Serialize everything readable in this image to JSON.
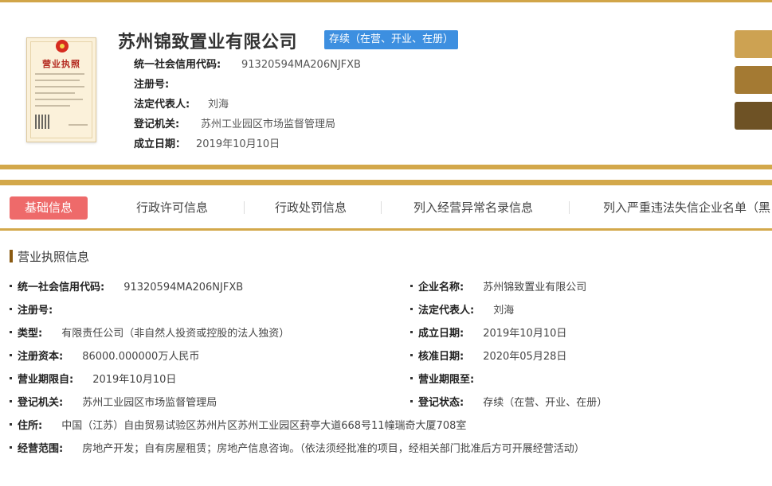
{
  "header": {
    "company_name": "苏州锦致置业有限公司",
    "status": "存续（在营、开业、在册）",
    "credit_code_label": "统一社会信用代码:",
    "credit_code": "91320594MA206NJFXB",
    "reg_no_label": "注册号:",
    "reg_no": "",
    "legal_rep_label": "法定代表人:",
    "legal_rep": "刘海",
    "authority_label": "登记机关:",
    "authority": "苏州工业园区市场监督管理局",
    "est_date_label": "成立日期：",
    "est_date": "2019年10月10日"
  },
  "license": {
    "title": "营业执照"
  },
  "tabs": [
    {
      "label": "基础信息",
      "active": true
    },
    {
      "label": "行政许可信息"
    },
    {
      "label": "行政处罚信息"
    },
    {
      "label": "列入经营异常名录信息"
    },
    {
      "label": "列入严重违法失信企业名单（黑"
    }
  ],
  "section": {
    "title": "营业执照信息",
    "fields": {
      "credit_code": {
        "label": "统一社会信用代码:",
        "value": "91320594MA206NJFXB"
      },
      "company_name": {
        "label": "企业名称:",
        "value": "苏州锦致置业有限公司"
      },
      "reg_no": {
        "label": "注册号:",
        "value": ""
      },
      "legal_rep": {
        "label": "法定代表人:",
        "value": "刘海"
      },
      "type": {
        "label": "类型:",
        "value": "有限责任公司（非自然人投资或控股的法人独资）"
      },
      "est_date": {
        "label": "成立日期:",
        "value": "2019年10月10日"
      },
      "capital": {
        "label": "注册资本:",
        "value": "86000.000000万人民币"
      },
      "approve_date": {
        "label": "核准日期:",
        "value": "2020年05月28日"
      },
      "term_from": {
        "label": "营业期限自:",
        "value": "2019年10月10日"
      },
      "term_to": {
        "label": "营业期限至:",
        "value": ""
      },
      "authority": {
        "label": "登记机关:",
        "value": "苏州工业园区市场监督管理局"
      },
      "reg_status": {
        "label": "登记状态:",
        "value": "存续（在营、开业、在册）"
      },
      "address": {
        "label": "住所:",
        "value": "中国（江苏）自由贸易试验区苏州片区苏州工业园区葑亭大道668号11幢瑞奇大厦708室"
      },
      "scope": {
        "label": "经营范围:",
        "value": "房地产开发；自有房屋租赁；房地产信息咨询。（依法须经批准的项目，经相关部门批准后方可开展经营活动）"
      }
    }
  },
  "colors": {
    "gold": "#d3a84b",
    "badge": "#3d8fe0",
    "active_tab": "#ee6a6a"
  }
}
